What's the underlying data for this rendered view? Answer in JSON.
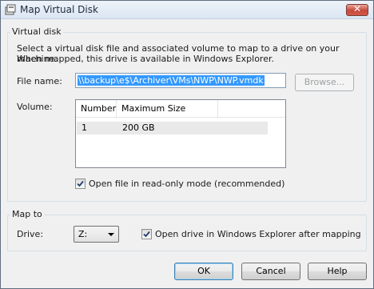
{
  "window": {
    "title": "Map Virtual Disk",
    "close_symbol": "✕"
  },
  "virtual_disk": {
    "group_label": "Virtual disk",
    "description_line1": "Select a virtual disk file and associated volume to map to a drive on your machine.",
    "description_line2": "When mapped, this drive is available in Windows Explorer.",
    "file_name_label": "File name:",
    "file_name_value": "\\\\backup\\e$\\Archiver\\VMs\\NWP\\NWP.vmdk",
    "browse_label": "Browse...",
    "volume_label": "Volume:",
    "volume_table": {
      "columns": [
        "Number",
        "Maximum Size"
      ],
      "rows": [
        {
          "number": "1",
          "max_size": "200 GB"
        }
      ]
    },
    "read_only_label": "Open file in read-only mode (recommended)",
    "read_only_checked": true
  },
  "map_to": {
    "group_label": "Map to",
    "drive_label": "Drive:",
    "drive_value": "Z:",
    "open_explorer_label": "Open drive in Windows Explorer after mapping",
    "open_explorer_checked": true
  },
  "buttons": {
    "ok": "OK",
    "cancel": "Cancel",
    "help": "Help"
  },
  "icons": {
    "title": "map-disk-icon",
    "close": "close-icon",
    "dropdown": "chevron-down-icon",
    "check": "checkmark-icon"
  }
}
